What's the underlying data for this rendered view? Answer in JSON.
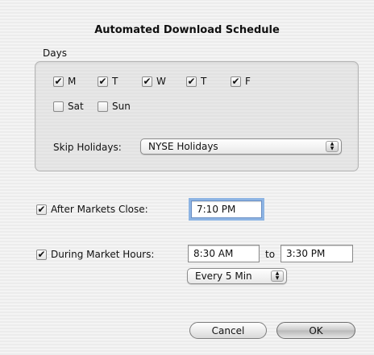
{
  "dialog": {
    "title": "Automated Download Schedule",
    "days_label": "Days"
  },
  "days": [
    {
      "label": "M",
      "checked": true
    },
    {
      "label": "T",
      "checked": true
    },
    {
      "label": "W",
      "checked": true
    },
    {
      "label": "T",
      "checked": true
    },
    {
      "label": "F",
      "checked": true
    },
    {
      "label": "Sat",
      "checked": false
    },
    {
      "label": "Sun",
      "checked": false
    }
  ],
  "skip_holidays": {
    "label": "Skip Holidays:",
    "value": "NYSE Holidays"
  },
  "after_close": {
    "checked": true,
    "label": "After Markets Close:",
    "time": "7:10 PM"
  },
  "during_hours": {
    "checked": true,
    "label": "During Market Hours:",
    "start": "8:30 AM",
    "to_label": "to",
    "end": "3:30 PM",
    "interval": "Every 5 Min"
  },
  "buttons": {
    "cancel": "Cancel",
    "ok": "OK"
  },
  "icons": {
    "check": "✔",
    "popup_arrows": "popup-arrows-icon"
  }
}
